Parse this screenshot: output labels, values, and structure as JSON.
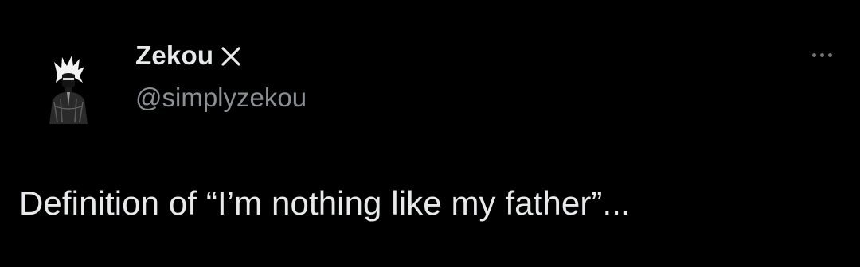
{
  "tweet": {
    "author": {
      "display_name": "Zekou",
      "handle": "@simplyzekou",
      "avatar_icon": "avatar-illustration",
      "badge_icon": "x-icon"
    },
    "more_icon": "more-options-icon",
    "text": "Definition of “I’m nothing like my father”..."
  },
  "colors": {
    "background": "#000000",
    "primary_text": "#e7e9ea",
    "secondary_text": "#8b9095"
  }
}
